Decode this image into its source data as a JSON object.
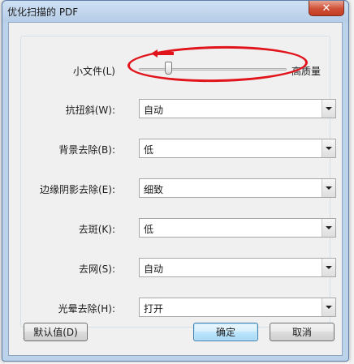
{
  "window": {
    "title": "优化扫描的 PDF",
    "close_glyph": "✕"
  },
  "slider": {
    "left_label": "小文件(L)",
    "right_label": "高质量",
    "level_fraction": 0.2
  },
  "fields": [
    {
      "label": "抗扭斜(W):",
      "value": "自动"
    },
    {
      "label": "背景去除(B):",
      "value": "低"
    },
    {
      "label": "边缘阴影去除(E):",
      "value": "细致"
    },
    {
      "label": "去斑(K):",
      "value": "低"
    },
    {
      "label": "去网(S):",
      "value": "自动"
    },
    {
      "label": "光晕去除(H):",
      "value": "打开"
    }
  ],
  "buttons": {
    "defaults_label": "默认值(D)",
    "ok_label": "确定",
    "cancel_label": "取消"
  },
  "annotation": {
    "color": "#e1141c"
  },
  "colors": {
    "titlebar": "#bcd1ea",
    "dialog_bg": "#f0f0f0",
    "close_button": "#c23b22",
    "default_button_border": "#3c7fb1"
  }
}
